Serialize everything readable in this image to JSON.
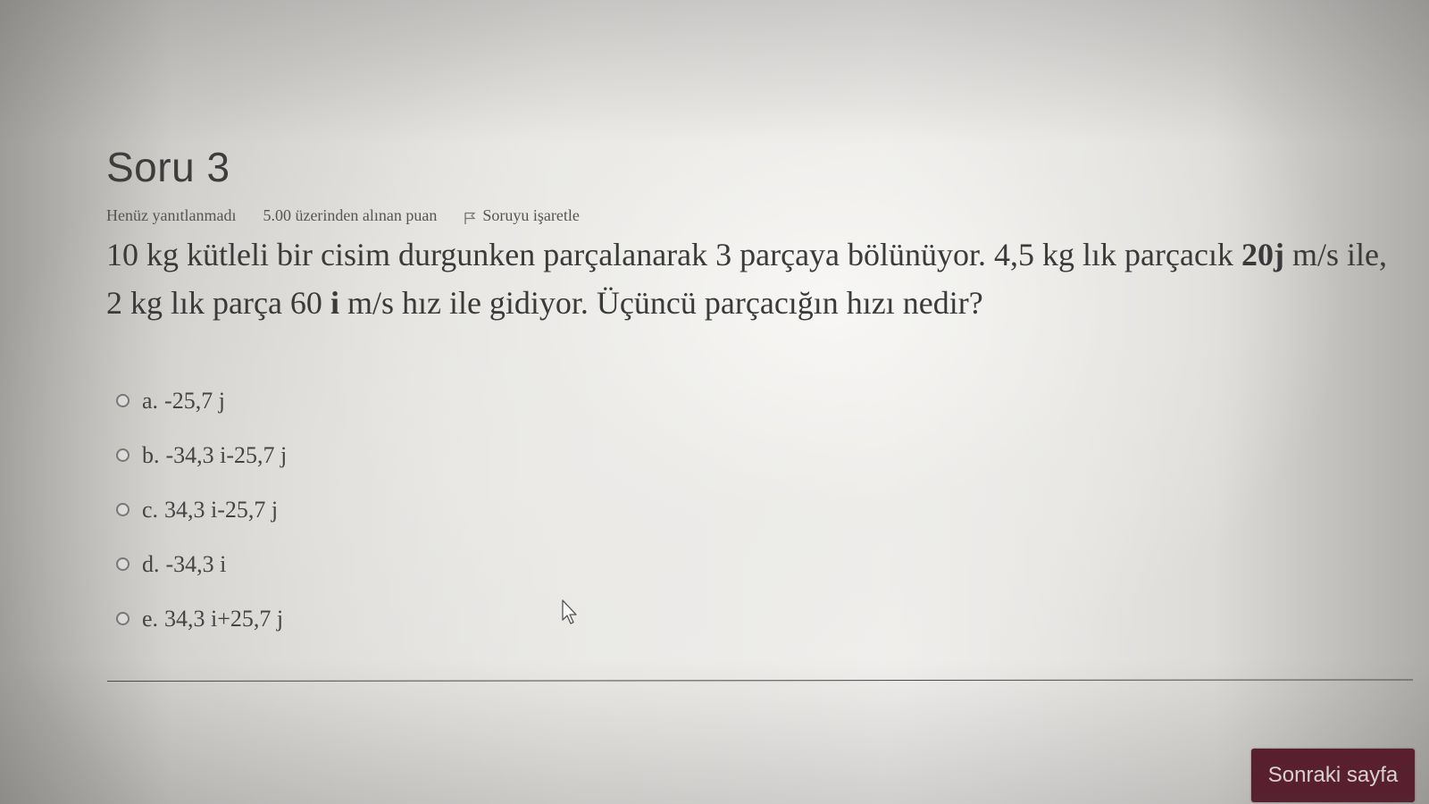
{
  "question": {
    "title": "Soru 3",
    "state": "Henüz yanıtlanmadı",
    "grade": "5.00 üzerinden alınan puan",
    "flag_label": "Soruyu işaretle",
    "text_part1": "10 kg kütleli bir cisim durgunken parçalanarak 3 parçaya bölünüyor. 4,5 kg lık parçacık ",
    "text_bold1": "20j",
    "text_part2": " m/s ile, 2 kg lık parça  60 ",
    "text_bold2": "i",
    "text_part3": " m/s hız ile gidiyor. Üçüncü parçacığın hızı nedir?"
  },
  "answers": [
    {
      "letter": "a.",
      "value": "-25,7 j"
    },
    {
      "letter": "b.",
      "value": "-34,3 i-25,7 j"
    },
    {
      "letter": "c.",
      "value": "34,3 i-25,7 j"
    },
    {
      "letter": "d.",
      "value": "-34,3 i"
    },
    {
      "letter": "e.",
      "value": "34,3 i+25,7 j"
    }
  ],
  "navigation": {
    "next_label": "Sonraki sayfa"
  },
  "colors": {
    "button_bg": "#5d1b2c",
    "text": "#3a3a3a"
  },
  "icons": {
    "flag": "flag-icon",
    "radio": "radio-icon",
    "cursor": "mouse-pointer-icon"
  }
}
